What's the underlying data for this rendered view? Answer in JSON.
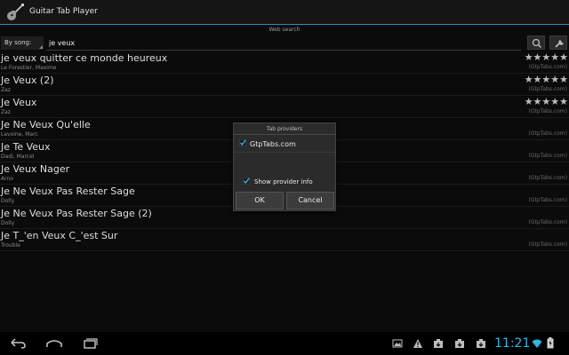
{
  "app": {
    "title": "Guitar Tab Player",
    "icon": "guitar-icon"
  },
  "header": {
    "web_search": "Web search"
  },
  "search": {
    "mode": "By song:",
    "query": "je veux"
  },
  "results": [
    {
      "title": "je veux quitter ce monde heureux",
      "artist": "Le Forestier, Maxime",
      "source": "(GtpTabs.com)",
      "stars": "★★★★★"
    },
    {
      "title": "Je Veux (2)",
      "artist": "Zaz",
      "source": "(GtpTabs.com)",
      "stars": "★★★★★"
    },
    {
      "title": "Je Veux",
      "artist": "Zaz",
      "source": "(GtpTabs.com)",
      "stars": "★★★★★"
    },
    {
      "title": "Je Ne Veux Qu'elle",
      "artist": "Lavoine, Marc",
      "source": "(GtpTabs.com)"
    },
    {
      "title": "Je Te Veux",
      "artist": "Dadi, Marcel",
      "source": "(GtpTabs.com)"
    },
    {
      "title": "Je Veux Nager",
      "artist": "Arno",
      "source": "(GtpTabs.com)"
    },
    {
      "title": "Je Ne Veux Pas Rester Sage",
      "artist": "Dolly",
      "source": "(GtpTabs.com)"
    },
    {
      "title": "Je Ne Veux Pas Rester Sage (2)",
      "artist": "Dolly",
      "source": "(GtpTabs.com)"
    },
    {
      "title": "Je T_'en Veux C_'est Sur",
      "artist": "Trouble",
      "source": "(GtpTabs.com)"
    }
  ],
  "dialog": {
    "title": "Tab providers",
    "provider": "GtpTabs.com",
    "provider_checked": true,
    "show_info": "Show provider info",
    "show_info_checked": true,
    "ok": "OK",
    "cancel": "Cancel"
  },
  "status_bar": {
    "time": "11:21"
  },
  "colors": {
    "accent": "#33b5e5",
    "separator": "#2a8ec4",
    "background": "#0b0b0b"
  }
}
